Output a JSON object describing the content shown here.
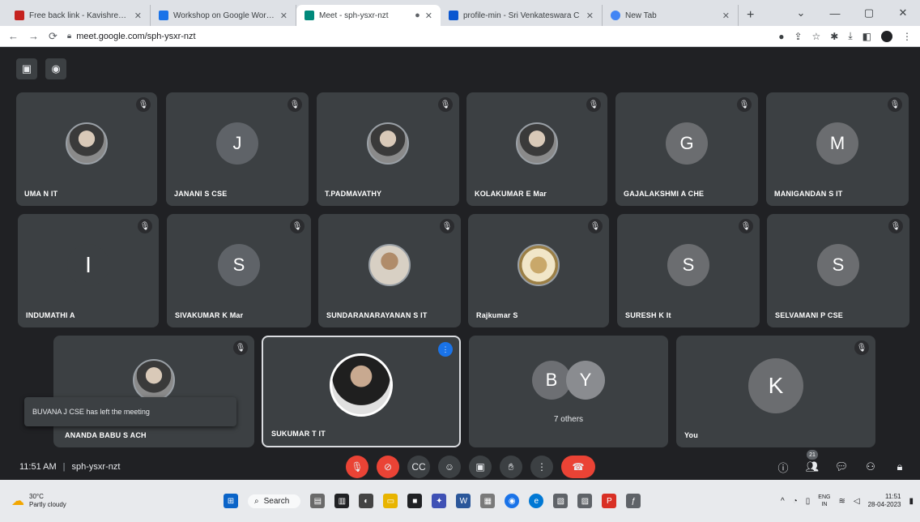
{
  "browser": {
    "tabs": [
      {
        "label": "Free back link - Kavishree@wo",
        "active": false
      },
      {
        "label": "Workshop on Google Workspac",
        "active": false
      },
      {
        "label": "Meet - sph-ysxr-nzt",
        "active": true
      },
      {
        "label": "profile-min - Sri Venkateswara C",
        "active": false
      },
      {
        "label": "New Tab",
        "active": false
      }
    ],
    "new_tab": "+",
    "url": "meet.google.com/sph-ysxr-nzt"
  },
  "meet": {
    "participants": [
      {
        "name": "UMA N IT",
        "avatar": "photo"
      },
      {
        "name": "JANANI S CSE",
        "avatar": "J"
      },
      {
        "name": "T.PADMAVATHY",
        "avatar": "photo"
      },
      {
        "name": "KOLAKUMAR E Mar",
        "avatar": "photo"
      },
      {
        "name": "GAJALAKSHMI A CHE",
        "avatar": "G"
      },
      {
        "name": "MANIGANDAN S IT",
        "avatar": "M"
      },
      {
        "name": "INDUMATHI A",
        "avatar": "I"
      },
      {
        "name": "SIVAKUMAR K Mar",
        "avatar": "S"
      },
      {
        "name": "SUNDARANARAYANAN S IT",
        "avatar": "photo"
      },
      {
        "name": "Rajkumar S",
        "avatar": "photo"
      },
      {
        "name": "SURESH K It",
        "avatar": "S"
      },
      {
        "name": "SELVAMANI P CSE",
        "avatar": "S"
      },
      {
        "name": "ANANDA BABU S ACH",
        "avatar": "photo"
      },
      {
        "name": "SUKUMAR T IT",
        "avatar": "photo"
      },
      {
        "name": "You",
        "avatar": "K"
      }
    ],
    "others": {
      "initials": [
        "B",
        "Y"
      ],
      "label": "7 others"
    },
    "toast": "BUVANA J CSE has left the meeting",
    "time": "11:51 AM",
    "meeting_code": "sph-ysxr-nzt",
    "people_count": "21"
  },
  "taskbar": {
    "weather_temp": "30°C",
    "weather_desc": "Partly cloudy",
    "search_label": "Search",
    "lang_top": "ENG",
    "lang_bottom": "IN",
    "clock_time": "11:51",
    "clock_date": "28-04-2023"
  }
}
